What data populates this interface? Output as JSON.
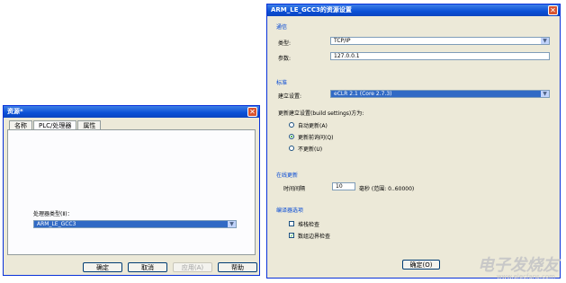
{
  "left_dialog": {
    "title": "资源*",
    "tabs": [
      "名称",
      "PLC/处理器",
      "属性"
    ],
    "processor_label": "处理器类型(Ⅱ)：",
    "processor_value": "ARM_LE_GCC3",
    "buttons": {
      "ok": "确定",
      "cancel": "取消",
      "apply": "应用(A)",
      "help": "帮助"
    }
  },
  "right_dialog": {
    "title": "ARM_LE_GCC3的资源设置",
    "comm": {
      "section": "通信",
      "protocol_label": "类型:",
      "protocol_value": "TCP/IP",
      "param_label": "参数:",
      "param_value": "127.0.0.1"
    },
    "build": {
      "section": "标准",
      "setting_label": "建立设置:",
      "setting_value": "eCLR 2.1 (Core 2.7.3)",
      "update_title": "更新建立设置(build settings)方为:",
      "options": [
        "自动更新(A)",
        "更新前询问(Q)",
        "不更新(U)"
      ],
      "selected_index": 1
    },
    "online": {
      "section": "在线更新",
      "interval_label": "时间间隔",
      "interval_value": "10",
      "interval_unit": "毫秒 (范围: 0..60000)"
    },
    "compiler": {
      "section": "编译器选项",
      "checks": [
        {
          "label": "堆栈检查",
          "checked": false
        },
        {
          "label": "数组边界检查",
          "checked": true
        }
      ]
    },
    "ok_button": "确定(O)"
  },
  "watermark": {
    "main": "电子发烧友",
    "sub": "www.elecfans.com"
  }
}
